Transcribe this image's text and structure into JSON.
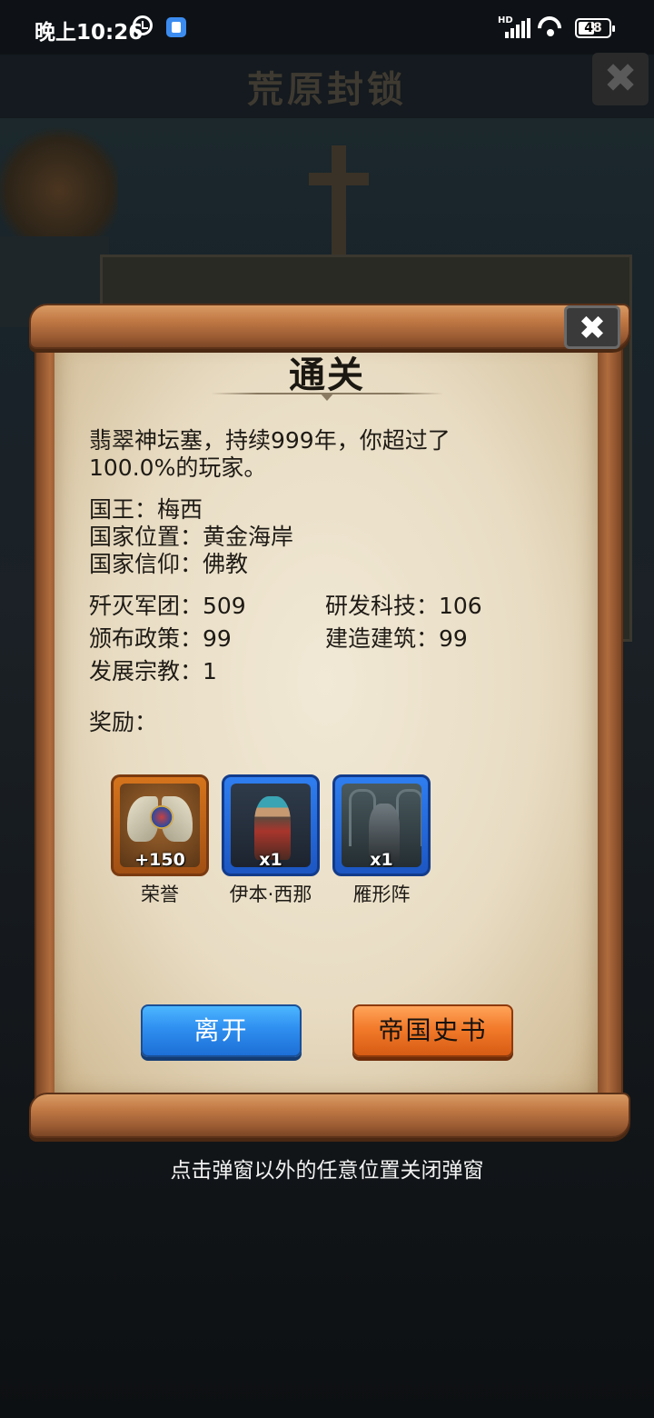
{
  "status_bar": {
    "time": "晚上10:26",
    "network": "HD",
    "battery": "48"
  },
  "background": {
    "title": "荒原封锁"
  },
  "dialog": {
    "title": "通关",
    "summary": "翡翠神坛塞，持续999年，你超过了100.0%的玩家。",
    "info": [
      {
        "label": "国王",
        "sep": "：",
        "value": "梅西"
      },
      {
        "label": "国家位置",
        "sep": "：",
        "value": "黄金海岸"
      },
      {
        "label": "国家信仰",
        "sep": "：",
        "value": "佛教"
      }
    ],
    "stats": {
      "legions_destroyed": "歼灭军团：509",
      "tech_researched": "研发科技：106",
      "policies_issued": "颁布政策：99",
      "buildings_built": "建造建筑：99",
      "religion_developed": "发展宗教：1"
    },
    "rewards_label": "奖励：",
    "rewards": [
      {
        "name": "荣誉",
        "quantity": "+150",
        "icon": "honor-emblem-icon"
      },
      {
        "name": "伊本·西那",
        "quantity": "x1",
        "icon": "hero-portrait-icon"
      },
      {
        "name": "雁形阵",
        "quantity": "x1",
        "icon": "formation-card-icon"
      }
    ],
    "buttons": {
      "leave": "离开",
      "history": "帝国史书"
    }
  },
  "hint": "点击弹窗以外的任意位置关闭弹窗",
  "colors": {
    "parchment": "#e8dcc3",
    "scroll_wood": "#c27a45",
    "leave_button": "#2f8ff0",
    "history_button": "#f27a2a",
    "honor_card": "#d5741c",
    "unit_card": "#2f7ef0"
  }
}
